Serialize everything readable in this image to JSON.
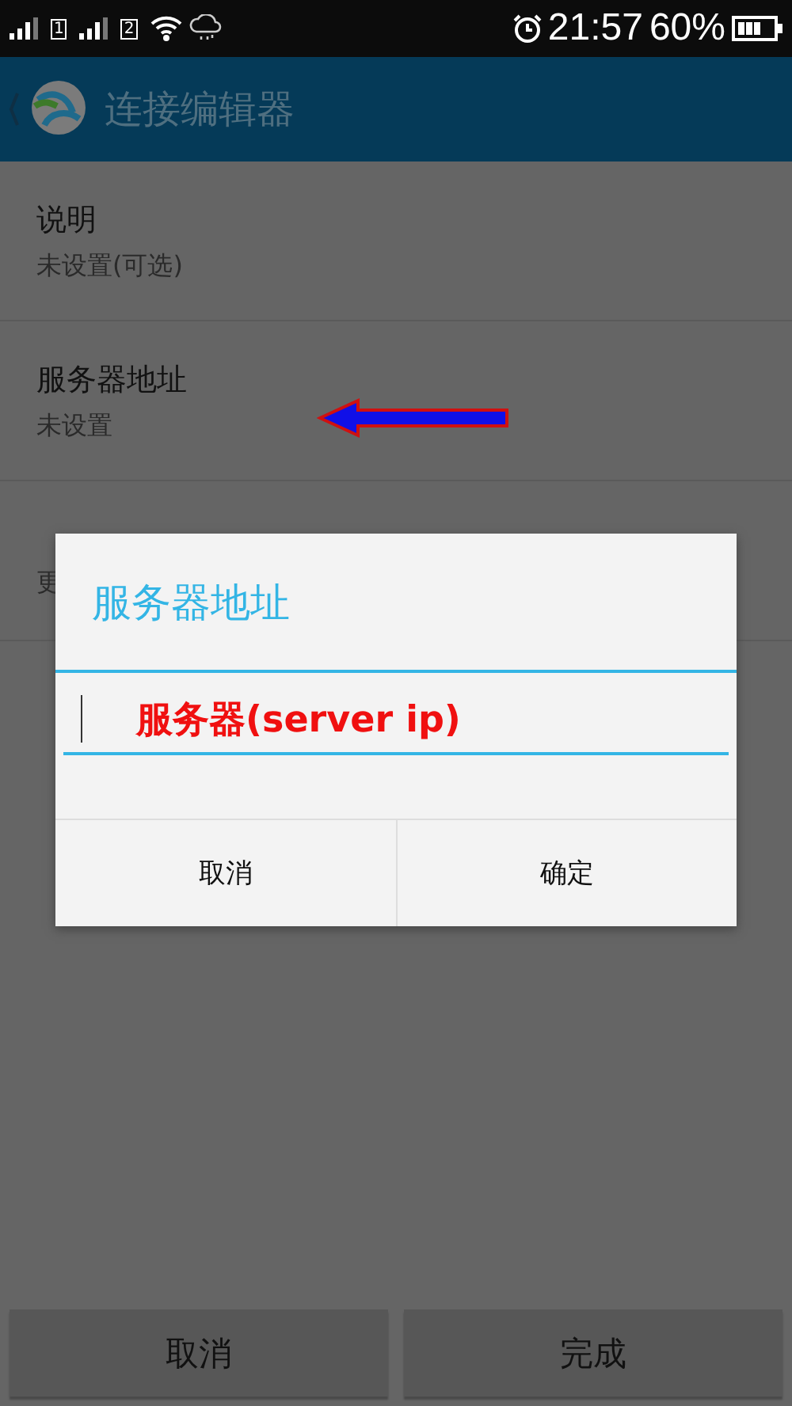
{
  "status_bar": {
    "sim_labels": [
      "1",
      "2"
    ],
    "time": "21:57",
    "battery": "60%"
  },
  "app_bar": {
    "title": "连接编辑器"
  },
  "settings": [
    {
      "title": "说明",
      "value": "未设置(可选)"
    },
    {
      "title": "服务器地址",
      "value": "未设置",
      "annotated": true
    },
    {
      "value": "更"
    }
  ],
  "dialog": {
    "title": "服务器地址",
    "field_value": "服务器(server ip)",
    "buttons": [
      "取消",
      "确定"
    ]
  },
  "bottom_buttons": [
    "取消",
    "完成"
  ]
}
